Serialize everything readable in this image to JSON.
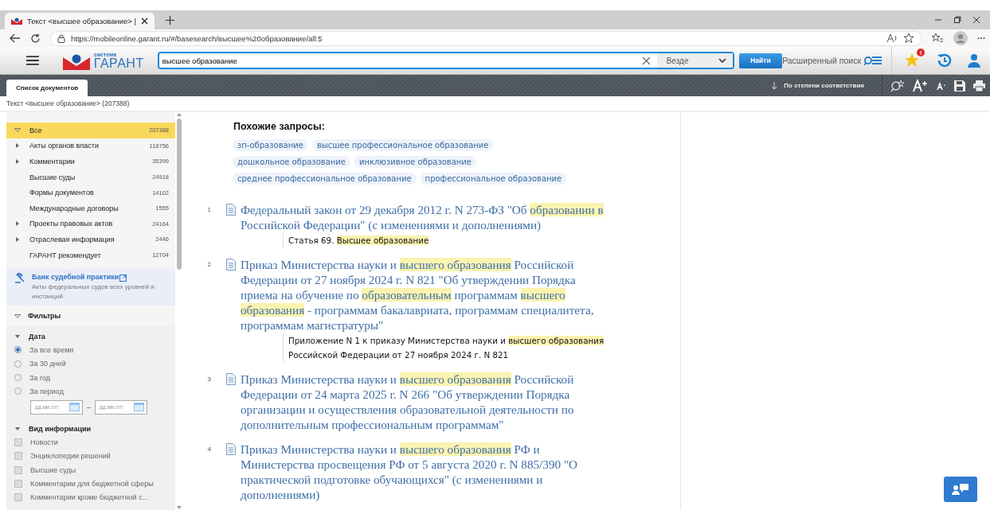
{
  "browser": {
    "tab_title": "Текст <высшее образование> |",
    "url": "https://mobileonline.garant.ru/#/basesearch/высшее%20образование/all:5"
  },
  "header": {
    "logo_small": "система",
    "logo_big": "ГАРАНТ",
    "search_value": "высшее образование",
    "scope": "Везде",
    "find_button": "Найти",
    "advanced_search": "Расширенный поиск",
    "favorites_alert": "!"
  },
  "toolbar": {
    "tabs": [
      {
        "label": "Список документов",
        "selected": true
      }
    ],
    "sort": "По степени соответствия"
  },
  "breadcrumb": "Текст <высшее образование> (207388)",
  "sidebar": {
    "categories": [
      {
        "label": "Все",
        "count": "207388",
        "expandable": true,
        "expanded": true,
        "selected": true
      },
      {
        "label": "Акты органов власти",
        "count": "118756",
        "expandable": true,
        "expanded": false,
        "selected": false
      },
      {
        "label": "Комментарии",
        "count": "35399",
        "expandable": true,
        "expanded": false,
        "selected": false
      },
      {
        "label": "Высшие суды",
        "count": "24918",
        "expandable": false,
        "selected": false
      },
      {
        "label": "Формы документов",
        "count": "14102",
        "expandable": false,
        "selected": false
      },
      {
        "label": "Международные договоры",
        "count": "1555",
        "expandable": false,
        "selected": false
      },
      {
        "label": "Проекты правовых актов",
        "count": "24164",
        "expandable": true,
        "expanded": false,
        "selected": false
      },
      {
        "label": "Отраслевая информация",
        "count": "2446",
        "expandable": true,
        "expanded": false,
        "selected": false
      },
      {
        "label": "ГАРАНТ рекомендует",
        "count": "12704",
        "expandable": false,
        "selected": false
      }
    ],
    "bank": {
      "title": "Банк судебной практики",
      "subtitle": "Акты федеральных судов всех уровней и инстанций"
    },
    "filters_title": "Фильтры",
    "date": {
      "title": "Дата",
      "options": [
        {
          "label": "За все время",
          "selected": true
        },
        {
          "label": "За 30 дней",
          "selected": false
        },
        {
          "label": "За год",
          "selected": false
        },
        {
          "label": "За период",
          "selected": false
        }
      ],
      "from_placeholder": "дд.мм.гггг",
      "to_placeholder": "дд.мм.гггг",
      "separator": "–"
    },
    "info_type": {
      "title": "Вид информации",
      "options": [
        {
          "label": "Новости",
          "checked": false
        },
        {
          "label": "Энциклопедии решений",
          "checked": false
        },
        {
          "label": "Высшие суды",
          "checked": false
        },
        {
          "label": "Комментарии для бюджетной сферы",
          "checked": false
        },
        {
          "label": "Комментарии кроме бюджетной с...",
          "checked": false
        }
      ]
    }
  },
  "similar": {
    "title": "Похожие запросы:",
    "queries": [
      "зп-образование",
      "высшее профессиональное образование",
      "дошкольное образование",
      "инклюзивное образование",
      "среднее профессиональное образование",
      "профессиональное образование"
    ]
  },
  "results": [
    {
      "number": "1",
      "title": [
        {
          "text": "Федеральный закон от 29 декабря 2012 г. N 273-ФЗ \"Об ",
          "hl": false
        },
        {
          "text": "образовании в",
          "hl": true
        },
        {
          "text": " Российской Федерации\" (с изменениями и дополнениями)",
          "hl": false
        }
      ],
      "snippet": [
        {
          "text": "Статья 69. ",
          "hl": false
        },
        {
          "text": "Высшее образование",
          "hl": true
        }
      ]
    },
    {
      "number": "2",
      "title": [
        {
          "text": "Приказ Министерства науки и ",
          "hl": false
        },
        {
          "text": "высшего образования",
          "hl": true
        },
        {
          "text": " Российской Федерации от 27 ноября 2024 г. N 821 \"Об утверждении Порядка приема на обучение по ",
          "hl": false
        },
        {
          "text": "образовательным",
          "hl": true
        },
        {
          "text": " программам ",
          "hl": false
        },
        {
          "text": "высшего образования",
          "hl": true
        },
        {
          "text": " - программам бакалавриата, программам специалитета, программам магистратуры\"",
          "hl": false
        }
      ],
      "snippet": [
        {
          "text": "Приложение N 1 к приказу Министерства науки и ",
          "hl": false
        },
        {
          "text": "высшего образования",
          "hl": true
        },
        {
          "text": " Российской Федерации от 27 ноября 2024 г. N 821",
          "hl": false
        }
      ]
    },
    {
      "number": "3",
      "title": [
        {
          "text": "Приказ Министерства науки и ",
          "hl": false
        },
        {
          "text": "высшего образования",
          "hl": true
        },
        {
          "text": " Российской Федерации от 24 марта 2025 г. N 266 \"Об утверждении Порядка организации и осуществления образовательной деятельности по дополнительным профессиональным программам\"",
          "hl": false
        }
      ]
    },
    {
      "number": "4",
      "title": [
        {
          "text": "Приказ Министерства науки и ",
          "hl": false
        },
        {
          "text": "высшего образования",
          "hl": true
        },
        {
          "text": " РФ и Министерства просвещения РФ от 5 августа 2020 г. N 885/390 \"О практической подготовке обучающихся\" (с изменениями и дополнениями)",
          "hl": false
        }
      ]
    }
  ]
}
